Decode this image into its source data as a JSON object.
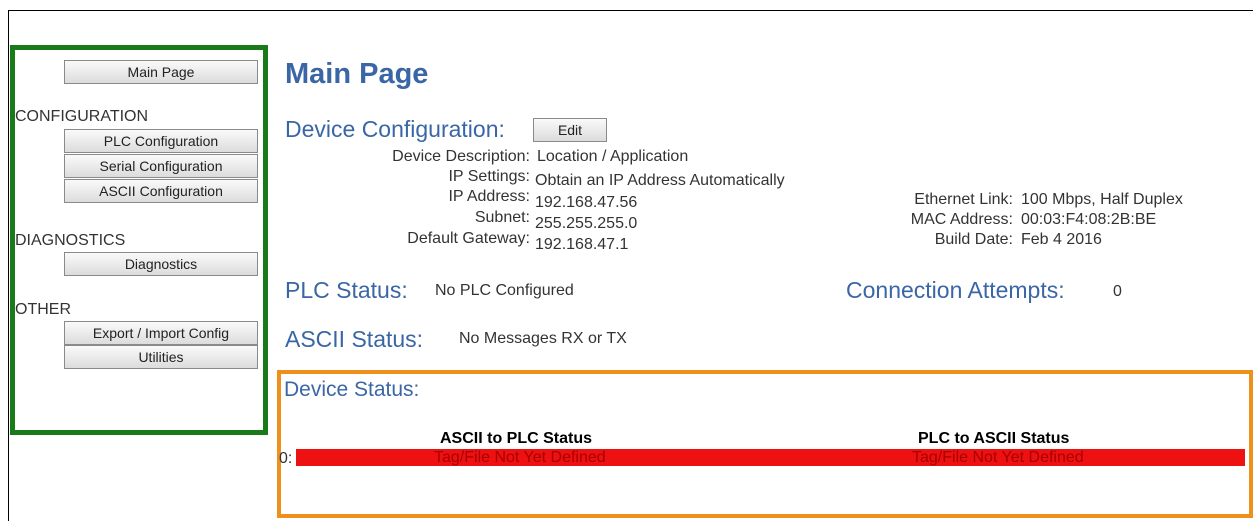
{
  "sidebar": {
    "main_page": "Main Page",
    "configuration_heading": "CONFIGURATION",
    "plc_configuration": "PLC Configuration",
    "serial_configuration": "Serial Configuration",
    "ascii_configuration": "ASCII Configuration",
    "diagnostics_heading": "DIAGNOSTICS",
    "diagnostics": "Diagnostics",
    "other_heading": "OTHER",
    "export_import": "Export / Import Config",
    "utilities": "Utilities"
  },
  "page_title": "Main Page",
  "device_config": {
    "heading": "Device Configuration:",
    "edit_label": "Edit",
    "device_description_label": "Device Description:",
    "device_description": "Location / Application",
    "ip_settings_label": "IP Settings:",
    "ip_settings": "Obtain an IP Address Automatically",
    "ip_address_label": "IP Address:",
    "ip_address": "192.168.47.56",
    "subnet_label": "Subnet:",
    "subnet": "255.255.255.0",
    "gateway_label": "Default Gateway:",
    "gateway": "192.168.47.1",
    "ethernet_link_label": "Ethernet Link:",
    "ethernet_link": "100 Mbps, Half Duplex",
    "mac_label": "MAC Address:",
    "mac": "00:03:F4:08:2B:BE",
    "build_date_label": "Build Date:",
    "build_date": "Feb 4 2016"
  },
  "plc_status": {
    "heading": "PLC Status:",
    "value": "No PLC Configured"
  },
  "connection_attempts": {
    "heading": "Connection Attempts:",
    "value": "0"
  },
  "ascii_status": {
    "heading": "ASCII Status:",
    "value": "No Messages RX or TX"
  },
  "device_status": {
    "heading": "Device Status:",
    "col1": "ASCII to PLC Status",
    "col2": "PLC to ASCII Status",
    "row_label": "0:",
    "row_col1": "Tag/File Not Yet Defined",
    "row_col2": "Tag/File Not Yet Defined"
  },
  "colors": {
    "accent_blue": "#3a66a6",
    "sidebar_border": "#1a7a1a",
    "status_border": "#f0901c",
    "error_red": "#ee1111"
  }
}
